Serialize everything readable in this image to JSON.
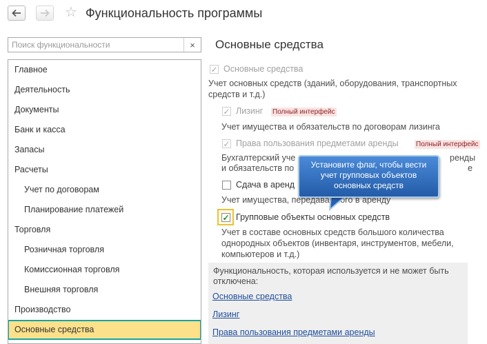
{
  "header": {
    "back_icon": "back-arrow-icon",
    "forward_icon": "forward-arrow-icon",
    "favorite_icon": "star-icon",
    "title": "Функциональность программы"
  },
  "search": {
    "placeholder": "Поиск функциональности",
    "clear_label": "×"
  },
  "nav": {
    "items": [
      {
        "label": "Главное"
      },
      {
        "label": "Деятельность"
      },
      {
        "label": "Документы"
      },
      {
        "label": "Банк и касса"
      },
      {
        "label": "Запасы"
      },
      {
        "label": "Расчеты"
      },
      {
        "label": "Учет по договорам"
      },
      {
        "label": "Планирование платежей"
      },
      {
        "label": "Торговля"
      },
      {
        "label": "Розничная торговля"
      },
      {
        "label": "Комиссионная торговля"
      },
      {
        "label": "Внешняя торговля"
      },
      {
        "label": "Производство"
      },
      {
        "label": "Основные средства"
      }
    ]
  },
  "main": {
    "section_title": "Основные средства",
    "options": {
      "fixed_assets": {
        "label": "Основные средства",
        "checked": true,
        "description": "Учет основных средств (зданий, оборудования, транспортных средств и т.д.)"
      },
      "leasing": {
        "label": "Лизинг",
        "badge": "Полный интерфейс",
        "checked": true,
        "description": "Учет имущества и обязательств  по договорам лизинга"
      },
      "lease_rights": {
        "label": "Права пользования предметами аренды",
        "badge": "Полный интерфейс",
        "checked": true,
        "description_line1": "Бухгалтерский уче",
        "description_line1_tail": "ренды",
        "description_line2": "и обязательств по",
        "description_line2_tail": "е"
      },
      "rent": {
        "label": "Сдача в аренд",
        "checked": false,
        "description": "Учет имущества, передаваемого в аренду"
      },
      "group_objects": {
        "label": "Групповые объекты основных средств",
        "checked": true,
        "description": "Учет в составе основных средств большого количества однородных объектов (инвентаря, инструментов, мебели, компьютеров и т.д.)"
      }
    },
    "tooltip": "Установите флаг, чтобы вести учет групповых объектов основных средств",
    "info": {
      "text": "Функциональность, которая используется и не может быть отключена:",
      "links": [
        {
          "label": "Основные средства"
        },
        {
          "label": "Лизинг"
        },
        {
          "label": "Права пользования предметами аренды"
        }
      ]
    }
  },
  "colors": {
    "selected_bg": "#fce18a",
    "selected_border": "#16a4a4",
    "tooltip_bg": "#2f6fc0",
    "link": "#1f4e9c",
    "badge_text": "#8a1f1f",
    "badge_bg": "#fbe3e3"
  }
}
